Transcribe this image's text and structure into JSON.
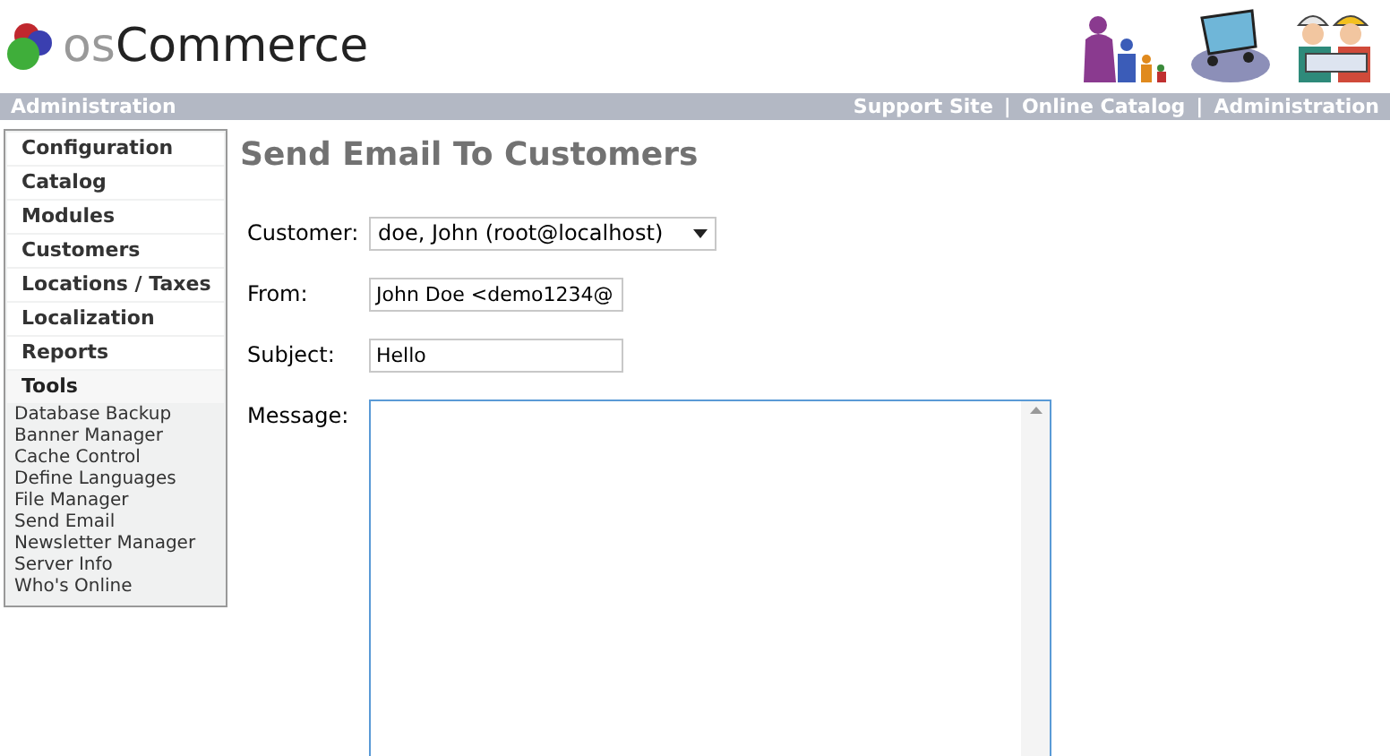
{
  "header": {
    "logo": {
      "prefix": "os",
      "name": "Commerce"
    }
  },
  "top_bar": {
    "title": "Administration",
    "links": [
      "Support Site",
      "Online Catalog",
      "Administration"
    ],
    "separator": "|"
  },
  "sidebar": {
    "sections": [
      {
        "label": "Configuration",
        "expanded": false
      },
      {
        "label": "Catalog",
        "expanded": false
      },
      {
        "label": "Modules",
        "expanded": false
      },
      {
        "label": "Customers",
        "expanded": false
      },
      {
        "label": "Locations / Taxes",
        "expanded": false
      },
      {
        "label": "Localization",
        "expanded": false
      },
      {
        "label": "Reports",
        "expanded": false
      },
      {
        "label": "Tools",
        "expanded": true,
        "children": [
          "Database Backup",
          "Banner Manager",
          "Cache Control",
          "Define Languages",
          "File Manager",
          "Send Email",
          "Newsletter Manager",
          "Server Info",
          "Who's Online"
        ]
      }
    ]
  },
  "page": {
    "title": "Send Email To Customers",
    "fields": [
      {
        "kind": "select",
        "label": "Customer:",
        "value": "doe, John (root@localhost)"
      },
      {
        "kind": "text",
        "label": "From:",
        "value": "John Doe <demo1234@"
      },
      {
        "kind": "text",
        "label": "Subject:",
        "value": "Hello"
      },
      {
        "kind": "textarea",
        "label": "Message:",
        "focused": true
      }
    ]
  }
}
